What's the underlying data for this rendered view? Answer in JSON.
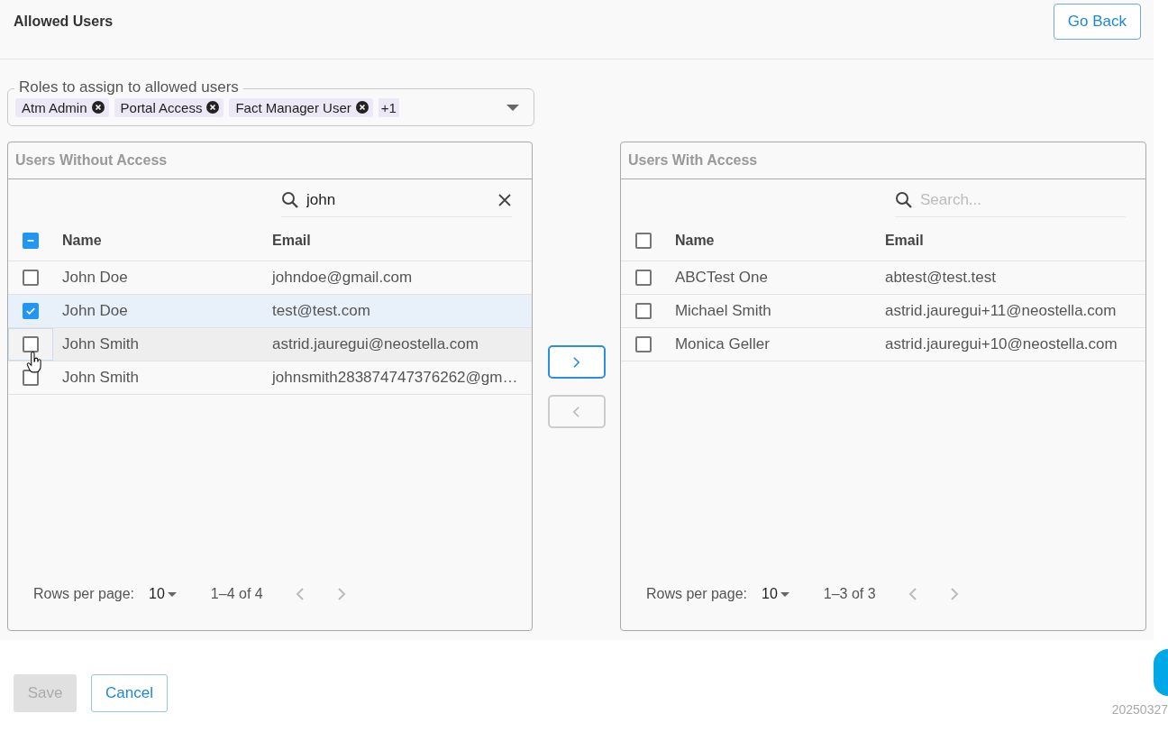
{
  "header": {
    "title": "Allowed Users",
    "back_button": "Go Back"
  },
  "roles_field": {
    "label": "Roles to assign to allowed users",
    "chips": [
      "Atm Admin",
      "Portal Access",
      "Fact Manager User"
    ],
    "more": "+1"
  },
  "panels": [
    {
      "title": "Users Without Access",
      "search": {
        "value": "john"
      },
      "select_all": {
        "indeterminate": true
      },
      "columns": [
        "Name",
        "Email"
      ],
      "rows": [
        {
          "name": "John Doe",
          "email": "johndoe@gmail.com",
          "checked": false,
          "hovered": false
        },
        {
          "name": "John Doe",
          "email": "test@test.com",
          "checked": true,
          "hovered": false
        },
        {
          "name": "John Smith",
          "email": "astrid.jauregui@neostella.com",
          "checked": false,
          "hovered": true
        },
        {
          "name": "John Smith",
          "email": "johnsmith283874747376262@gm…",
          "checked": false,
          "hovered": false
        }
      ],
      "pagination": {
        "label": "Rows per page:",
        "rows_per_page": "10",
        "range": "1–4 of 4"
      }
    },
    {
      "title": "Users With Access",
      "search": {
        "placeholder": "Search..."
      },
      "select_all": {
        "indeterminate": false
      },
      "columns": [
        "Name",
        "Email"
      ],
      "rows": [
        {
          "name": "ABCTest One",
          "email": "abtest@test.test",
          "checked": false,
          "hovered": false
        },
        {
          "name": "Michael Smith",
          "email": "astrid.jauregui+11@neostella.com",
          "checked": false,
          "hovered": false
        },
        {
          "name": "Monica Geller",
          "email": "astrid.jauregui+10@neostella.com",
          "checked": false,
          "hovered": false
        }
      ],
      "pagination": {
        "label": "Rows per page:",
        "rows_per_page": "10",
        "range": "1–3 of 3"
      }
    }
  ],
  "transfer_buttons": [
    {
      "kind": "right",
      "disabled": false
    },
    {
      "kind": "left",
      "disabled": true
    }
  ],
  "footer": {
    "save": {
      "label": "Save",
      "disabled": true
    },
    "cancel": "Cancel",
    "version": "20250327"
  }
}
